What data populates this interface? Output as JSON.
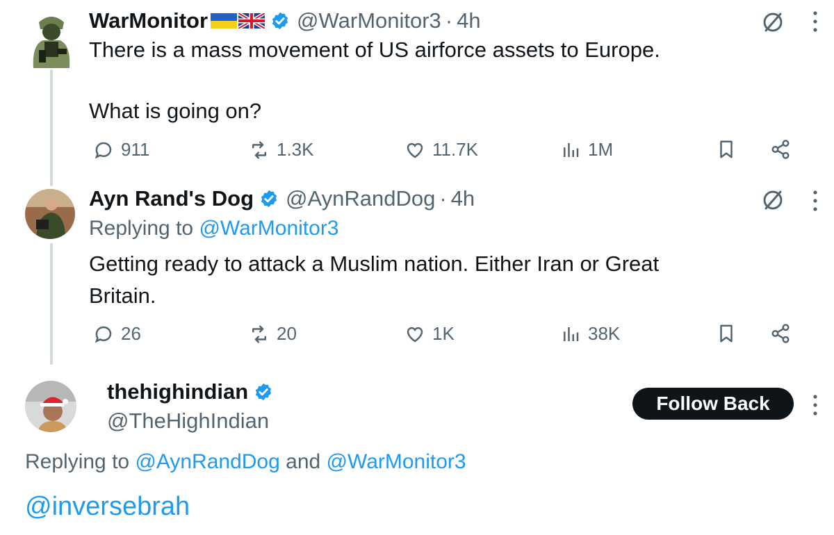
{
  "tweets": [
    {
      "display_name": "WarMonitor",
      "handle": "@WarMonitor3",
      "separator": "·",
      "time": "4h",
      "text_line1": "There is a mass movement of US airforce assets to Europe.",
      "text_line2": "What is going on?",
      "stats": {
        "replies": "911",
        "reposts": "1.3K",
        "likes": "11.7K",
        "views": "1M"
      }
    },
    {
      "display_name": "Ayn Rand's Dog",
      "handle": "@AynRandDog",
      "separator": "·",
      "time": "4h",
      "replying_prefix": "Replying to ",
      "replying_handle": "@WarMonitor3",
      "text_line1": "Getting ready to attack a Muslim nation. Either Iran or Great",
      "text_line2": "Britain.",
      "stats": {
        "replies": "26",
        "reposts": "20",
        "likes": "1K",
        "views": "38K"
      }
    },
    {
      "display_name": "thehighindian",
      "handle": "@TheHighIndian",
      "follow_label": "Follow Back",
      "replying_prefix": "Replying to ",
      "replying_handle1": "@AynRandDog",
      "replying_and": " and ",
      "replying_handle2": "@WarMonitor3",
      "body": "@inversebrah"
    }
  ],
  "colors": {
    "accent": "#1d9bf0",
    "text": "#0f1419",
    "muted": "#536471",
    "verified": "#1d9bf0"
  },
  "icons": [
    "reply-icon",
    "repost-icon",
    "like-icon",
    "views-icon",
    "bookmark-icon",
    "share-icon",
    "grok-icon",
    "more-icon",
    "verified-icon",
    "flag-ukraine-icon",
    "flag-uk-icon"
  ]
}
